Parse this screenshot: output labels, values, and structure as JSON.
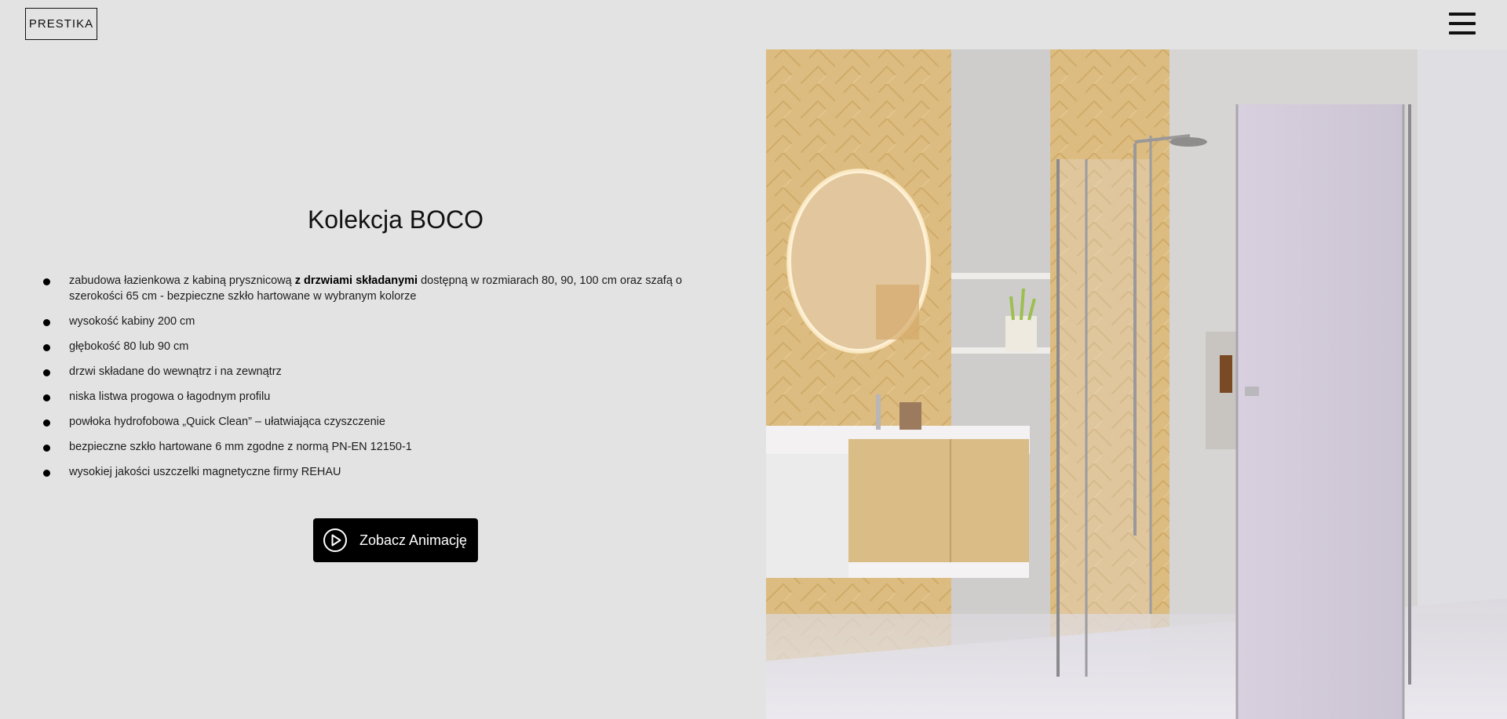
{
  "header": {
    "logo": "PRESTIKA",
    "menu_icon": "hamburger-menu-icon"
  },
  "main": {
    "title": "Kolekcja BOCO",
    "features": [
      {
        "pre": "zabudowa łazienkowa z kabiną prysznicową ",
        "bold": "z drzwiami składanymi",
        "post": " dostępną w rozmiarach 80, 90, 100 cm oraz szafą o szerokości 65 cm - bezpieczne szkło hartowane w wybranym kolorze"
      },
      {
        "pre": "wysokość kabiny 200 cm"
      },
      {
        "pre": "głębokość 80 lub 90 cm"
      },
      {
        "pre": "drzwi składane do wewnątrz i na zewnątrz"
      },
      {
        "pre": "niska listwa progowa o łagodnym profilu"
      },
      {
        "pre": "powłoka hydrofobowa „Quick Clean” – ułatwiająca czyszczenie"
      },
      {
        "pre": "bezpieczne szkło hartowane 6 mm zgodne z normą PN-EN 12150-1"
      },
      {
        "pre": "wysokiej jakości uszczelki magnetyczne firmy REHAU"
      }
    ],
    "animation_button": {
      "label": "Zobacz Animację",
      "icon": "play-circle-icon"
    }
  },
  "hero_image": {
    "colors": {
      "wood": "#d9b77a",
      "wall": "#d8d6d5",
      "floor": "#e4e2e6",
      "vanity": "#f2f0f0"
    }
  }
}
